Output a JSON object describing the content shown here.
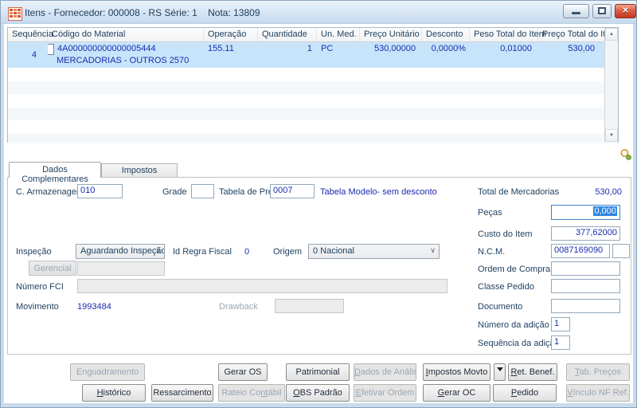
{
  "window": {
    "title": "Itens - Fornecedor: 000008 - RS Série: 1    Nota: 13809"
  },
  "icons": {
    "close_glyph": "✕",
    "scroll_up": "▲",
    "scroll_down": "▼",
    "dropdown_chevron": "∨"
  },
  "grid": {
    "columns": [
      "Sequência",
      "Código do Material",
      "Operação",
      "Quantidade",
      "Un. Med.",
      "Preço Unitário",
      "Desconto",
      "Peso Total do Item",
      "Preço Total do Item"
    ],
    "row": {
      "sequencia": "4",
      "codigo": "4A000000000000005444",
      "descricao": "MERCADORIAS - OUTROS 2570",
      "operacao": "155.11",
      "quantidade": "1",
      "un_med": "PC",
      "preco_unitario": "530,00000",
      "desconto": "0,0000%",
      "peso_total": "0,01000",
      "preco_total": "530,00"
    }
  },
  "tabs": {
    "dados_complementares": "Dados Complementares",
    "impostos": "Impostos"
  },
  "form": {
    "c_armazenagem": {
      "label": "C. Armazenagem",
      "value": "010"
    },
    "grade": {
      "label": "Grade",
      "value": ""
    },
    "tabela_preco": {
      "label": "Tabela de Preço",
      "value": "0007",
      "descricao": "Tabela Modelo- sem desconto"
    },
    "inspecao": {
      "label": "Inspeção",
      "value": "Aguardando Inspeção"
    },
    "id_regra_fiscal": {
      "label": "Id Regra Fiscal",
      "value": "0"
    },
    "origem": {
      "label": "Origem",
      "value": "0 Nacional"
    },
    "gerencial": {
      "label": "Gerencial",
      "value": ""
    },
    "numero_fci": {
      "label": "Número FCI",
      "value": ""
    },
    "movimento": {
      "label": "Movimento",
      "value": "1993484"
    },
    "drawback": {
      "label": "Drawback",
      "value": ""
    },
    "total_mercadorias": {
      "label": "Total de Mercadorias",
      "value": "530,00"
    },
    "pecas": {
      "label": "Peças",
      "value": "0,000"
    },
    "custo_item": {
      "label": "Custo do Item",
      "value": "377,62000"
    },
    "ncm": {
      "label": "N.C.M.",
      "value": "0087169090",
      "value2": ""
    },
    "ordem_compra": {
      "label": "Ordem de Compra",
      "value": ""
    },
    "classe_pedido": {
      "label": "Classe Pedido",
      "value": ""
    },
    "documento": {
      "label": "Documento",
      "value": ""
    },
    "numero_adicao": {
      "label": "Número da adição",
      "value": "1"
    },
    "sequencia_adicao": {
      "label": "Sequência da adição",
      "value": "1"
    }
  },
  "buttons": {
    "row1": [
      {
        "label": "Enguadramento"
      },
      {
        "label": "Gerar OS"
      },
      {
        "label": "Patrimonial"
      },
      {
        "label": "Dados de Análise",
        "key": "D"
      },
      {
        "label": "Impostos Movto",
        "key": "I"
      },
      {
        "label": "Ret. Benef.",
        "key": "R"
      },
      {
        "label": "Tab. Preços",
        "key": "T"
      }
    ],
    "row2": [
      {
        "label": "Histórico",
        "key": "H"
      },
      {
        "label": "Ressarcimento"
      },
      {
        "label": "Rateio Contábil",
        "key": "nt"
      },
      {
        "label": "OBS Padrão",
        "key": "O"
      },
      {
        "label": "Efetivar Ordem",
        "key": "E"
      },
      {
        "label": "Gerar OC",
        "key": "G"
      },
      {
        "label": "Pedido",
        "key": "P"
      },
      {
        "label": "Vínculo NF Ref.",
        "key": "V"
      }
    ]
  }
}
